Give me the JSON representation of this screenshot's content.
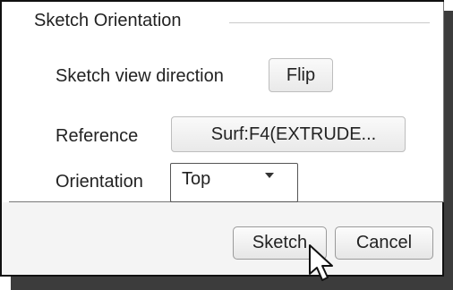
{
  "group": {
    "title": "Sketch Orientation"
  },
  "fields": {
    "view_direction_label": "Sketch view direction",
    "flip_label": "Flip",
    "reference_label": "Reference",
    "reference_value": "Surf:F4(EXTRUDE...",
    "orientation_label": "Orientation",
    "orientation_value": "Top"
  },
  "footer": {
    "sketch_label": "Sketch",
    "cancel_label": "Cancel"
  },
  "icons": {
    "dropdown": "chevron-down-icon",
    "cursor": "mouse-pointer-icon"
  }
}
